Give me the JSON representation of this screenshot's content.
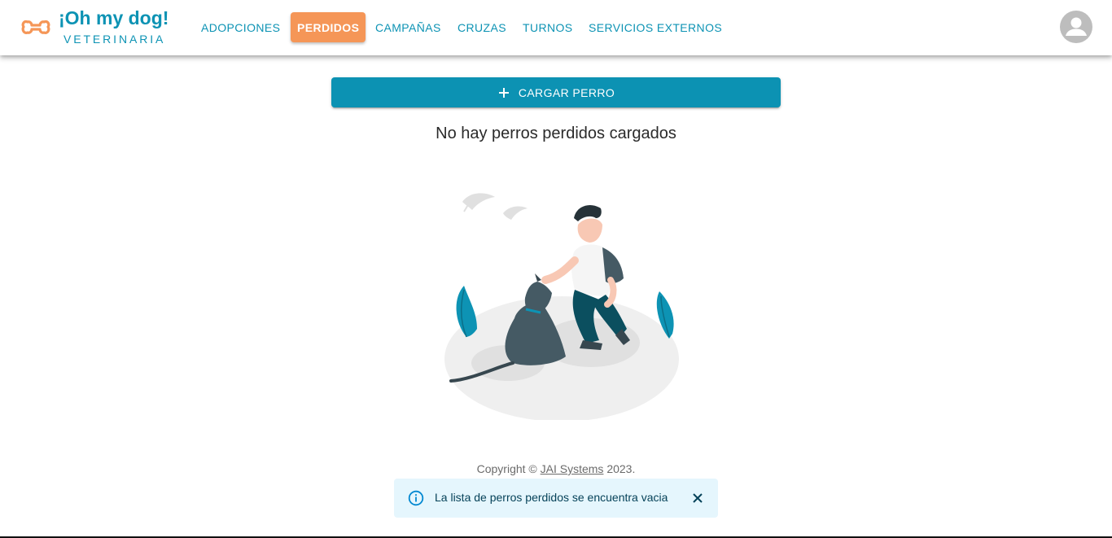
{
  "brand": {
    "title": "¡Oh my dog!",
    "subtitle": "VETERINARIA",
    "icon": "dog-bone-icon",
    "color": "#0d93b4",
    "icon_color": "#f59657"
  },
  "nav": {
    "items": [
      {
        "label": "Adopciones",
        "active": false
      },
      {
        "label": "Perdidos",
        "active": true
      },
      {
        "label": "Campañas",
        "active": false
      },
      {
        "label": "Cruzas",
        "active": false
      },
      {
        "label": "Turnos",
        "active": false
      },
      {
        "label": "Servicios Externos",
        "active": false
      }
    ],
    "active_color": "#f59657"
  },
  "user_menu": {
    "icon": "account-icon"
  },
  "main": {
    "add_button": {
      "label": "CARGAR PERRO",
      "icon": "plus-icon",
      "color": "#0c92b3"
    },
    "empty_message": "No hay perros perdidos cargados",
    "illustration": "man-petting-dog-illustration"
  },
  "footer": {
    "prefix": "Copyright © ",
    "link": "JAI Systems",
    "suffix": " 2023."
  },
  "toast": {
    "message": "La lista de perros perdidos se encuentra vacia",
    "icon": "info-icon",
    "close_icon": "close-icon",
    "severity": "info"
  }
}
